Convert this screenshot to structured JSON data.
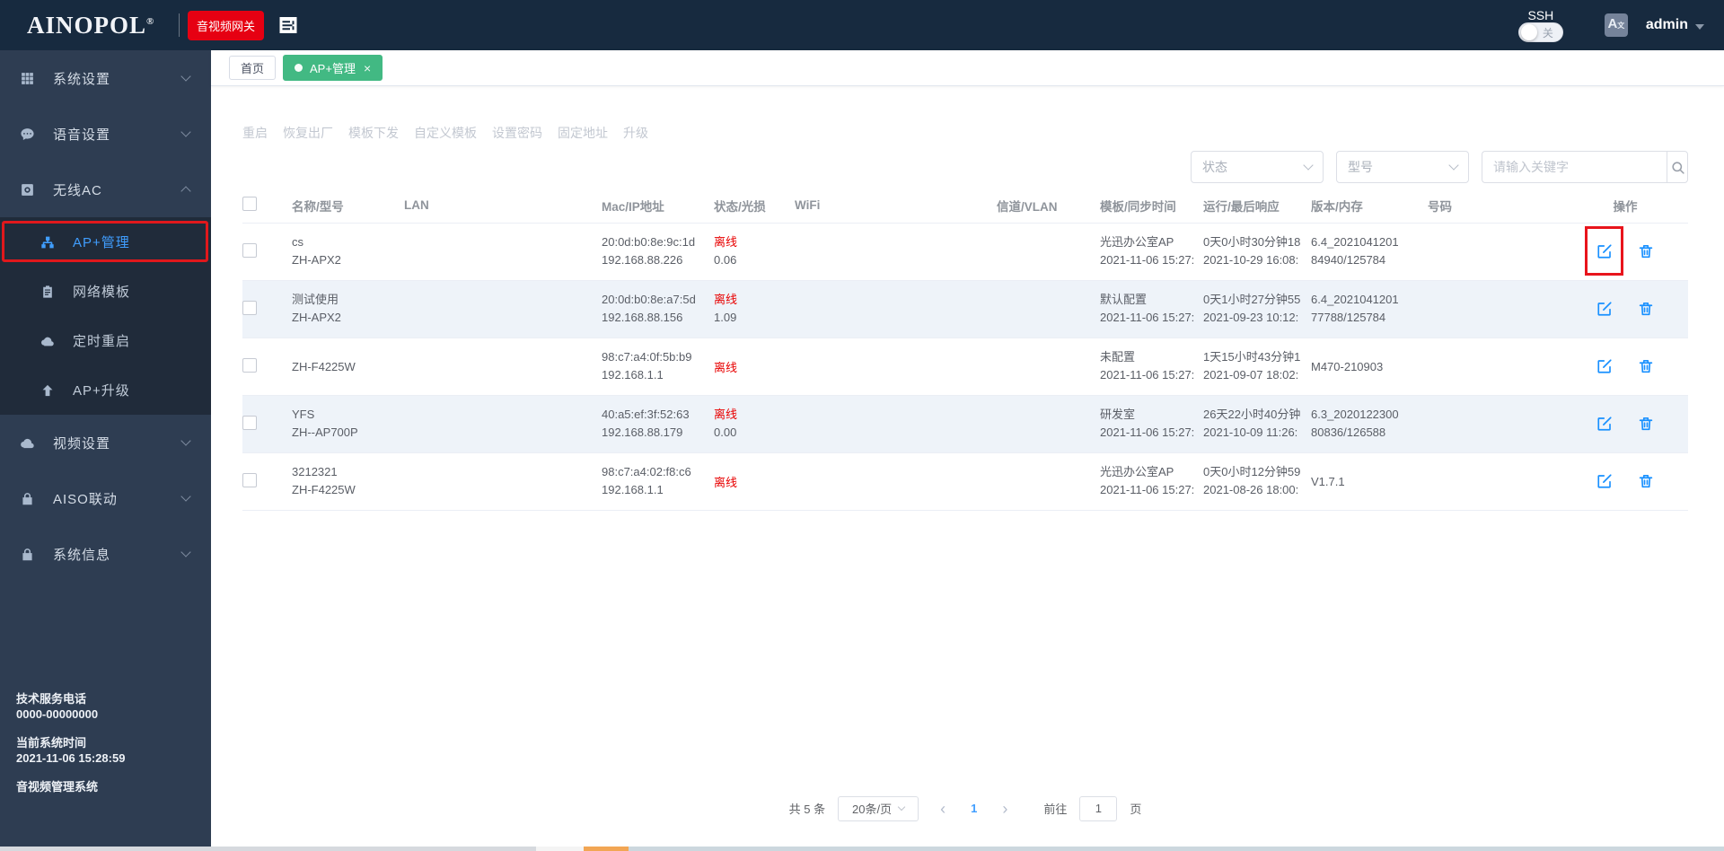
{
  "header": {
    "logo_text": "AINOPOL",
    "logo_mark": "®",
    "gateway_button": "音视频网关",
    "ssh_label": "SSH",
    "ssh_state": "关",
    "lang_icon_text": "A",
    "lang_icon_sup": "文",
    "username": "admin"
  },
  "sidebar": {
    "items": [
      {
        "id": "system-settings",
        "label": "系统设置",
        "icon": "grid-icon",
        "symbol": "i-grid",
        "type": "top",
        "chevron": "down"
      },
      {
        "id": "voice-settings",
        "label": "语音设置",
        "icon": "chat-icon",
        "symbol": "i-chat",
        "type": "top",
        "chevron": "down"
      },
      {
        "id": "wireless-ac",
        "label": "无线AC",
        "icon": "disc-icon",
        "symbol": "i-disc",
        "type": "top",
        "chevron": "up"
      },
      {
        "id": "ap-management",
        "label": "AP+管理",
        "icon": "share-icon",
        "symbol": "i-share",
        "type": "sub",
        "active": true,
        "annotated": true
      },
      {
        "id": "network-template",
        "label": "网络模板",
        "icon": "clipboard-icon",
        "symbol": "i-clipboard",
        "type": "sub"
      },
      {
        "id": "scheduled-reboot",
        "label": "定时重启",
        "icon": "cloud-icon",
        "symbol": "i-cloud",
        "type": "sub"
      },
      {
        "id": "ap-upgrade",
        "label": "AP+升级",
        "icon": "arrow-up-icon",
        "symbol": "i-arrowup",
        "type": "sub"
      },
      {
        "id": "video-settings",
        "label": "视频设置",
        "icon": "cloud-icon",
        "symbol": "i-cloud",
        "type": "top",
        "chevron": "down"
      },
      {
        "id": "aiso-linkage",
        "label": "AISO联动",
        "icon": "lock-icon",
        "symbol": "i-lock",
        "type": "top",
        "chevron": "down"
      },
      {
        "id": "system-info",
        "label": "系统信息",
        "icon": "lock-icon",
        "symbol": "i-lock",
        "type": "top",
        "chevron": "down"
      }
    ],
    "footer": {
      "service_label": "技术服务电话",
      "service_phone": "0000-00000000",
      "time_label": "当前系统时间",
      "system_time": "2021-11-06 15:28:59",
      "system_name": "音视频管理系统"
    }
  },
  "tabs": [
    {
      "label": "首页",
      "active": false
    },
    {
      "label": "AP+管理",
      "active": true
    }
  ],
  "toolbar": {
    "actions": [
      {
        "id": "reboot",
        "label": "重启"
      },
      {
        "id": "factory-reset",
        "label": "恢复出厂"
      },
      {
        "id": "template-push",
        "label": "模板下发"
      },
      {
        "id": "custom-template",
        "label": "自定义模板"
      },
      {
        "id": "set-password",
        "label": "设置密码"
      },
      {
        "id": "fixed-address",
        "label": "固定地址"
      },
      {
        "id": "upgrade",
        "label": "升级"
      }
    ]
  },
  "filters": {
    "status_placeholder": "状态",
    "model_placeholder": "型号",
    "search_placeholder": "请输入关键字"
  },
  "table": {
    "columns": [
      "名称/型号",
      "LAN",
      "Mac/IP地址",
      "状态/光损",
      "WiFi",
      "信道/VLAN",
      "模板/同步时间",
      "运行/最后响应",
      "版本/内存",
      "号码",
      "操作"
    ],
    "rows": [
      {
        "name": "cs",
        "model": "ZH-APX2",
        "lan": "",
        "mac": "20:0d:b0:8e:9c:1d",
        "ip": "192.168.88.226",
        "status": "离线",
        "loss": "0.06",
        "wifi": "",
        "channel_vlan": "",
        "template": "光迅办公室AP",
        "sync_time": "2021-11-06 15:27:",
        "uptime": "0天0小时30分钟18",
        "last_response": "2021-10-29 16:08:",
        "version": "6.4_2021041201",
        "memory": "84940/125784",
        "number": "",
        "stripe": false,
        "annotated": true
      },
      {
        "name": "测试使用",
        "model": "ZH-APX2",
        "lan": "",
        "mac": "20:0d:b0:8e:a7:5d",
        "ip": "192.168.88.156",
        "status": "离线",
        "loss": "1.09",
        "wifi": "",
        "channel_vlan": "",
        "template": "默认配置",
        "sync_time": "2021-11-06 15:27:",
        "uptime": "0天1小时27分钟55",
        "last_response": "2021-09-23 10:12:",
        "version": "6.4_2021041201",
        "memory": "77788/125784",
        "number": "",
        "stripe": true,
        "annotated": false
      },
      {
        "name": "",
        "model": "ZH-F4225W",
        "lan": "",
        "mac": "98:c7:a4:0f:5b:b9",
        "ip": "192.168.1.1",
        "status": "离线",
        "loss": "",
        "wifi": "",
        "channel_vlan": "",
        "template": "未配置",
        "sync_time": "2021-11-06 15:27:",
        "uptime": "1天15小时43分钟1",
        "last_response": "2021-09-07 18:02:",
        "version": "M470-210903",
        "memory": "",
        "number": "",
        "stripe": false,
        "annotated": false
      },
      {
        "name": "YFS",
        "model": "ZH--AP700P",
        "lan": "",
        "mac": "40:a5:ef:3f:52:63",
        "ip": "192.168.88.179",
        "status": "离线",
        "loss": "0.00",
        "wifi": "",
        "channel_vlan": "",
        "template": "研发室",
        "sync_time": "2021-11-06 15:27:",
        "uptime": "26天22小时40分钟",
        "last_response": "2021-10-09 11:26:",
        "version": "6.3_2020122300",
        "memory": "80836/126588",
        "number": "",
        "stripe": true,
        "annotated": false
      },
      {
        "name": "3212321",
        "model": "ZH-F4225W",
        "lan": "",
        "mac": "98:c7:a4:02:f8:c6",
        "ip": "192.168.1.1",
        "status": "离线",
        "loss": "",
        "wifi": "",
        "channel_vlan": "",
        "template": "光迅办公室AP",
        "sync_time": "2021-11-06 15:27:",
        "uptime": "0天0小时12分钟59",
        "last_response": "2021-08-26 18:00:",
        "version": "V1.7.1",
        "memory": "",
        "number": "",
        "stripe": false,
        "annotated": false
      }
    ]
  },
  "pagination": {
    "total": "共 5 条",
    "page_size": "20条/页",
    "prev": "‹",
    "next": "›",
    "current_page": "1",
    "goto_label": "前往",
    "goto_value": "1",
    "page_suffix": "页"
  },
  "colors": {
    "header_bg": "#172a3f",
    "sidebar_bg": "#2e3d52",
    "sidebar_sub_bg": "#202b3a",
    "accent_blue": "#409eff",
    "action_blue": "#1890ff",
    "danger_red": "#e80000",
    "annotation_red": "#e0181c",
    "tab_green": "#42b983",
    "gateway_red": "#e60012",
    "stripe_row_bg": "#eef3f9",
    "scrollbar_orange": "#f2a654"
  }
}
